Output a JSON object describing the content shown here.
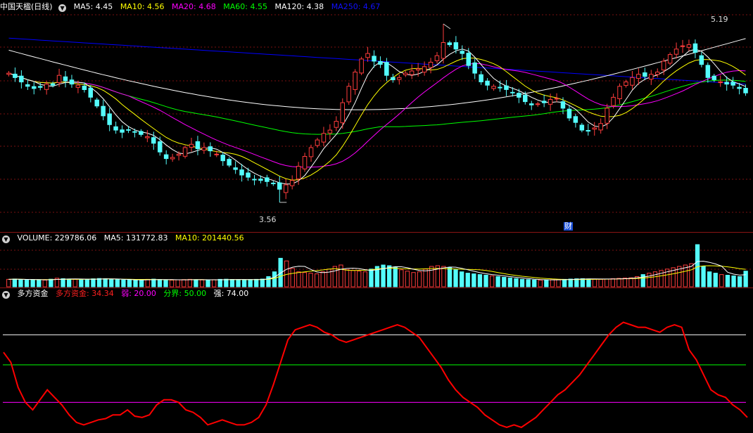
{
  "colors": {
    "up": "#ff3c3c",
    "down": "#54fcfc",
    "ma5": "#ffffff",
    "ma10": "#ffff00",
    "ma20": "#ff00ff",
    "ma60": "#00ff00",
    "ma120": "#ffffff",
    "ma250": "#0000ff",
    "duofang": "#ff0000",
    "grid": "#7a1010"
  },
  "price_header": {
    "title": "中国天楹(日线)",
    "ma5": "MA5: 4.45",
    "ma10": "MA10: 4.56",
    "ma20": "MA20: 4.68",
    "ma60": "MA60: 4.55",
    "ma120": "MA120: 4.38",
    "ma250": "MA250: 4.67"
  },
  "annotations": {
    "high_label": "5.19",
    "low_label": "3.56",
    "cai_marker": "财"
  },
  "volume_header": {
    "volume": "VOLUME: 229786.06",
    "ma5": "MA5: 131772.83",
    "ma10": "MA10: 201440.56"
  },
  "indicator_header": {
    "name": "多方资金",
    "value": "多方资金: 34.34",
    "weak": "弱: 20.00",
    "divide": "分界: 50.00",
    "strong": "强: 74.00"
  },
  "chart_data": [
    {
      "type": "candlestick",
      "title": "中国天楹(日线)",
      "ylim": [
        3.45,
        5.28
      ],
      "high": 5.19,
      "low": 3.56,
      "closes": [
        4.74,
        4.7,
        4.66,
        4.62,
        4.6,
        4.61,
        4.64,
        4.63,
        4.72,
        4.67,
        4.64,
        4.63,
        4.59,
        4.52,
        4.44,
        4.35,
        4.27,
        4.22,
        4.2,
        4.22,
        4.2,
        4.18,
        4.16,
        4.1,
        4.02,
        3.96,
        3.97,
        4.0,
        4.06,
        4.09,
        4.05,
        4.06,
        4.03,
        4.0,
        3.94,
        3.9,
        3.86,
        3.81,
        3.79,
        3.77,
        3.76,
        3.75,
        3.73,
        3.68,
        3.72,
        3.76,
        3.89,
        3.98,
        4.06,
        4.13,
        4.19,
        4.22,
        4.3,
        4.47,
        4.62,
        4.75,
        4.87,
        4.92,
        4.85,
        4.82,
        4.72,
        4.68,
        4.7,
        4.74,
        4.76,
        4.78,
        4.8,
        4.84,
        4.9,
        5.02,
        5.0,
        4.96,
        4.92,
        4.81,
        4.74,
        4.66,
        4.63,
        4.62,
        4.61,
        4.59,
        4.56,
        4.52,
        4.48,
        4.45,
        4.46,
        4.47,
        4.5,
        4.51,
        4.42,
        4.33,
        4.29,
        4.22,
        4.21,
        4.24,
        4.28,
        4.42,
        4.52,
        4.62,
        4.66,
        4.7,
        4.73,
        4.71,
        4.73,
        4.75,
        4.85,
        4.91,
        4.96,
        4.99,
        5.0,
        4.93,
        4.82,
        4.7,
        4.68,
        4.66,
        4.64,
        4.63,
        4.6,
        4.56
      ]
    },
    {
      "type": "bar",
      "title": "VOLUME",
      "values": [
        110,
        115,
        108,
        100,
        105,
        102,
        98,
        112,
        126,
        120,
        115,
        110,
        105,
        112,
        118,
        122,
        120,
        108,
        105,
        100,
        102,
        98,
        100,
        110,
        113,
        106,
        100,
        98,
        102,
        106,
        110,
        104,
        100,
        98,
        104,
        110,
        112,
        108,
        104,
        102,
        106,
        110,
        114,
        150,
        220,
        420,
        380,
        270,
        220,
        210,
        200,
        190,
        220,
        260,
        300,
        320,
        250,
        240,
        230,
        220,
        260,
        300,
        320,
        310,
        290,
        250,
        230,
        210,
        220,
        260,
        300,
        310,
        300,
        280,
        250,
        220,
        200,
        190,
        180,
        170,
        160,
        150,
        140,
        130,
        120,
        110,
        105,
        100,
        98,
        102,
        104,
        106,
        110,
        114,
        118,
        120,
        116,
        112,
        110,
        114,
        120,
        124,
        128,
        132,
        150,
        180,
        200,
        220,
        240,
        260,
        280,
        300,
        320,
        340,
        620,
        300,
        220,
        200,
        180,
        170,
        160,
        150,
        230
      ]
    },
    {
      "type": "line",
      "title": "多方资金",
      "ylim": [
        0,
        100
      ],
      "values": [
        60,
        52,
        32,
        20,
        14,
        22,
        30,
        24,
        18,
        10,
        4,
        2,
        4,
        6,
        7,
        10,
        10,
        14,
        9,
        8,
        10,
        18,
        22,
        22,
        20,
        14,
        12,
        8,
        2,
        4,
        6,
        4,
        2,
        2,
        4,
        8,
        18,
        34,
        52,
        70,
        78,
        80,
        82,
        80,
        76,
        74,
        70,
        68,
        70,
        72,
        74,
        76,
        78,
        80,
        82,
        80,
        76,
        72,
        64,
        56,
        48,
        38,
        30,
        24,
        20,
        16,
        10,
        6,
        2,
        0,
        2,
        0,
        4,
        8,
        14,
        20,
        26,
        30,
        36,
        42,
        50,
        58,
        66,
        74,
        80,
        84,
        82,
        80,
        80,
        78,
        76,
        80,
        82,
        80,
        62,
        54,
        42,
        30,
        26,
        24,
        18,
        14,
        8
      ]
    },
    {
      "type": "line",
      "title": "thresholds",
      "values": [
        74,
        50,
        20
      ]
    }
  ]
}
